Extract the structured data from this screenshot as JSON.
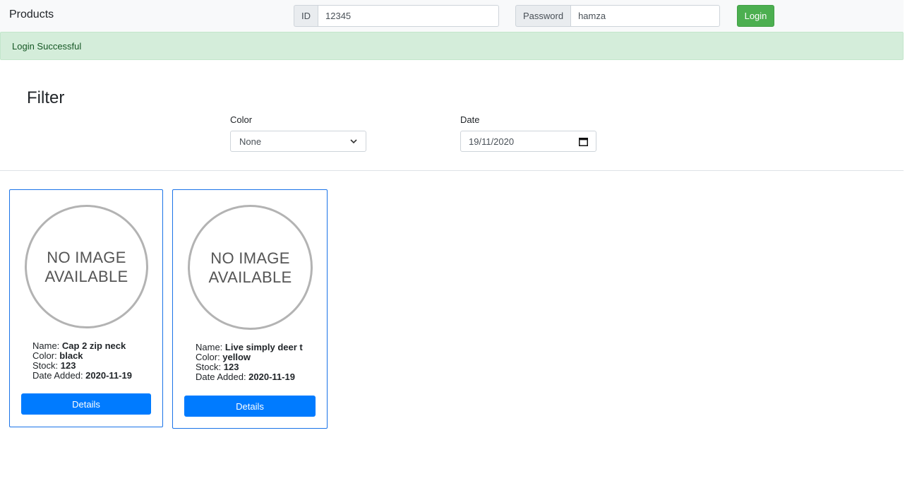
{
  "header": {
    "brand": "Products",
    "id_label": "ID",
    "id_value": "12345",
    "password_label": "Password",
    "password_value": "hamza",
    "login_label": "Login"
  },
  "alert": {
    "text": "Login Successful"
  },
  "filter": {
    "title": "Filter",
    "color_label": "Color",
    "color_value": "None",
    "date_label": "Date",
    "date_value": "19/11/2020"
  },
  "products": [
    {
      "image_text_line1": "NO IMAGE",
      "image_text_line2": "AVAILABLE",
      "name_label": "Name: ",
      "name": "Cap 2 zip neck",
      "color_label": "Color: ",
      "color": "black",
      "stock_label": "Stock: ",
      "stock": "123",
      "date_label": "Date Added: ",
      "date": "2020-11-19",
      "button_label": "Details"
    },
    {
      "image_text_line1": "NO IMAGE",
      "image_text_line2": "AVAILABLE",
      "name_label": "Name: ",
      "name": "Live simply deer t",
      "color_label": "Color: ",
      "color": "yellow",
      "stock_label": "Stock: ",
      "stock": "123",
      "date_label": "Date Added: ",
      "date": "2020-11-19",
      "button_label": "Details"
    }
  ],
  "colors": {
    "success": "#28a745",
    "primary": "#007bff",
    "alert_bg": "#d4edda",
    "alert_text": "#155724",
    "card_border": "#1a73e8"
  },
  "icons": {
    "select_caret": "chevron-down-icon",
    "date_picker": "calendar-icon"
  }
}
